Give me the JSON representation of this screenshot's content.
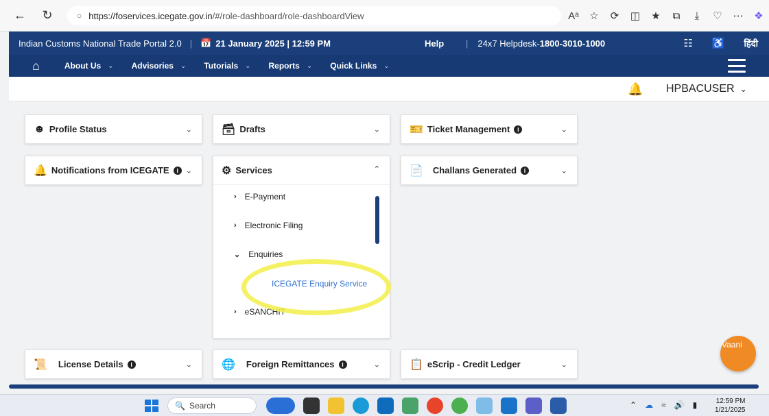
{
  "browser": {
    "url_host": "https://foservices.icegate.gov.in",
    "url_path": "/#/role-dashboard/role-dashboardView",
    "read_aloud_icon": "Aᵃ"
  },
  "header": {
    "brand": "Indian Customs National Trade Portal 2.0",
    "date": "21 January 2025 | 12:59 PM",
    "help": "Help",
    "helpdesk_prefix": "24x7 Helpdesk-",
    "helpdesk_number": "1800-3010-1000",
    "language": "हिंदी"
  },
  "nav": {
    "items": [
      "About Us",
      "Advisories",
      "Tutorials",
      "Reports",
      "Quick Links"
    ]
  },
  "user": {
    "name": "HPBACUSER"
  },
  "cards": {
    "profile_status": "Profile Status",
    "drafts": "Drafts",
    "ticket_management": "Ticket Management",
    "notifications": "Notifications from ICEGATE",
    "services": "Services",
    "challans_generated": "Challans Generated",
    "license_details": "License Details",
    "foreign_remittances": "Foreign Remittances",
    "escrip_credit_ledger": "eScrip - Credit Ledger"
  },
  "services_menu": {
    "items": [
      "E-Payment",
      "Electronic Filing",
      "Enquiries",
      "eSANCHIT"
    ],
    "sub_item": "ICEGATE Enquiry Service"
  },
  "chatbot": {
    "label": "Vaani"
  },
  "taskbar": {
    "search_label": "Search",
    "time": "12:59 PM",
    "date": "1/21/2025"
  },
  "colors": {
    "header_blue": "#1a3f7a",
    "link_blue": "#2f6fd1",
    "highlight_yellow": "#f3ee4a",
    "chatbot_orange": "#f08a24"
  }
}
